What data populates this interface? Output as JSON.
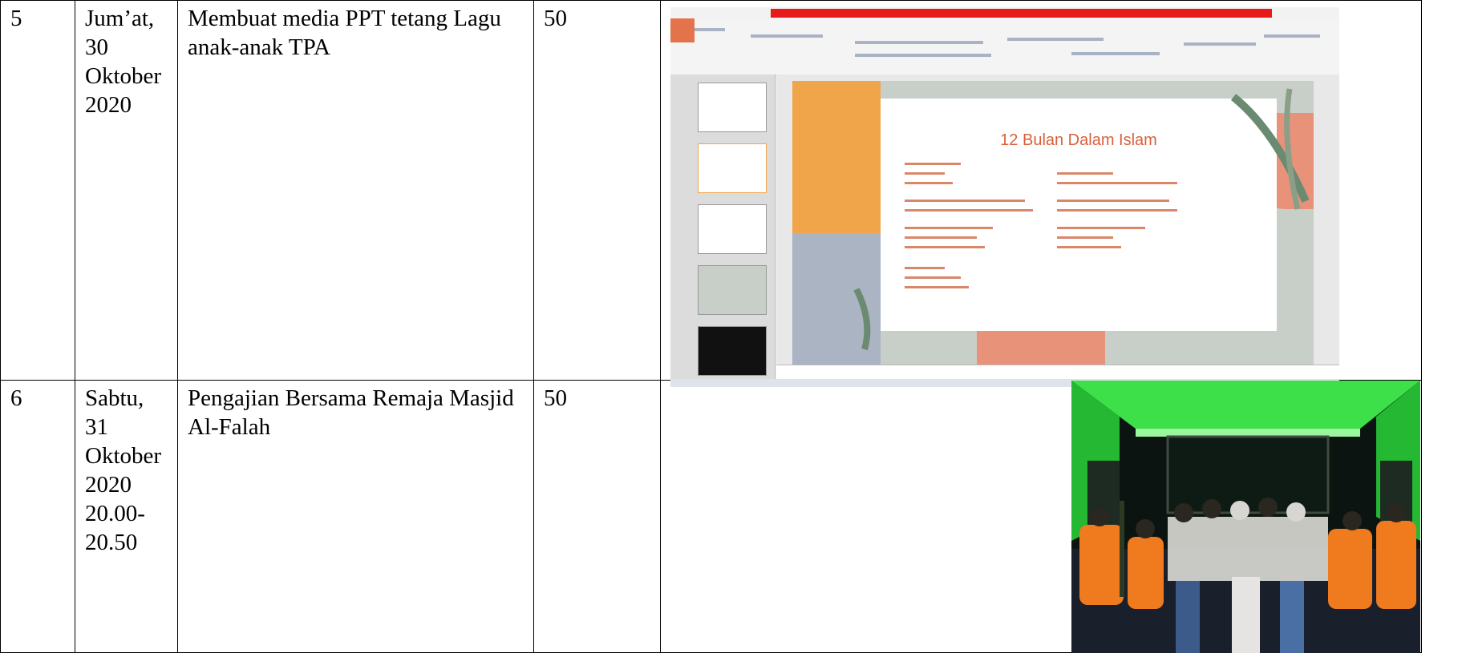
{
  "rows": [
    {
      "no": "5",
      "date": "Jum’at, 30 Oktober 2020",
      "activity": "Membuat  media PPT tetang Lagu anak-anak TPA",
      "duration": "50",
      "evidence": {
        "type": "powerpoint-screenshot",
        "slide_title": "12 Bulan Dalam Islam",
        "colors": {
          "title_bar": "#e81b1b",
          "accent_orange": "#f0a54a",
          "accent_salmon": "#e8927a",
          "sage": "#b8c4b8"
        }
      }
    },
    {
      "no": "6",
      "date": "Sabtu, 31 Oktober 2020 20.00-20.50",
      "activity": "Pengajian Bersama Remaja Masjid Al-Falah",
      "duration": "50",
      "evidence": {
        "type": "group-photo",
        "colors": {
          "wall_green": "#2ecc3c",
          "vest_orange": "#f07a1e",
          "night": "#0b1410"
        }
      }
    }
  ]
}
